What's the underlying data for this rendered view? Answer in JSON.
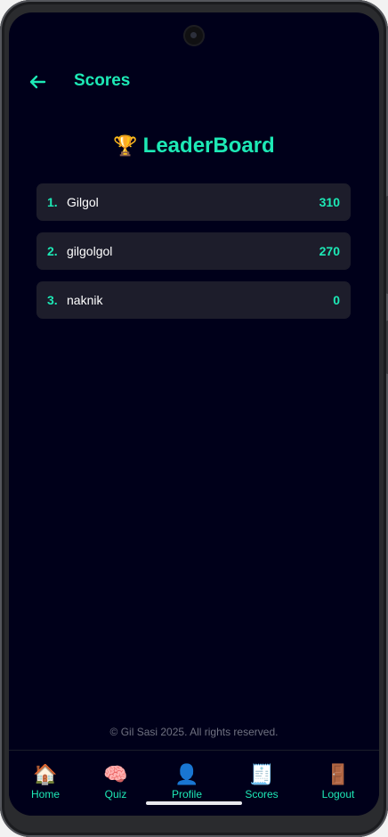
{
  "appbar": {
    "title": "Scores",
    "back_icon": "arrow-left-icon"
  },
  "leaderboard": {
    "title": "LeaderBoard",
    "title_icon": "🏆",
    "entries": [
      {
        "rank": "1.",
        "name": "Gilgol",
        "score": "310"
      },
      {
        "rank": "2.",
        "name": "gilgolgol",
        "score": "270"
      },
      {
        "rank": "3.",
        "name": "naknik",
        "score": "0"
      }
    ]
  },
  "footer": {
    "text": "© Gil Sasi 2025. All rights reserved."
  },
  "nav": {
    "items": [
      {
        "label": "Home",
        "icon": "🏠"
      },
      {
        "label": "Quiz",
        "icon": "🧠"
      },
      {
        "label": "Profile",
        "icon": "👤"
      },
      {
        "label": "Scores",
        "icon": "🧾"
      },
      {
        "label": "Logout",
        "icon": "🚪"
      }
    ]
  },
  "colors": {
    "accent": "#1de9b6",
    "background": "#00001a",
    "row_bg": "#1d1d2b"
  }
}
